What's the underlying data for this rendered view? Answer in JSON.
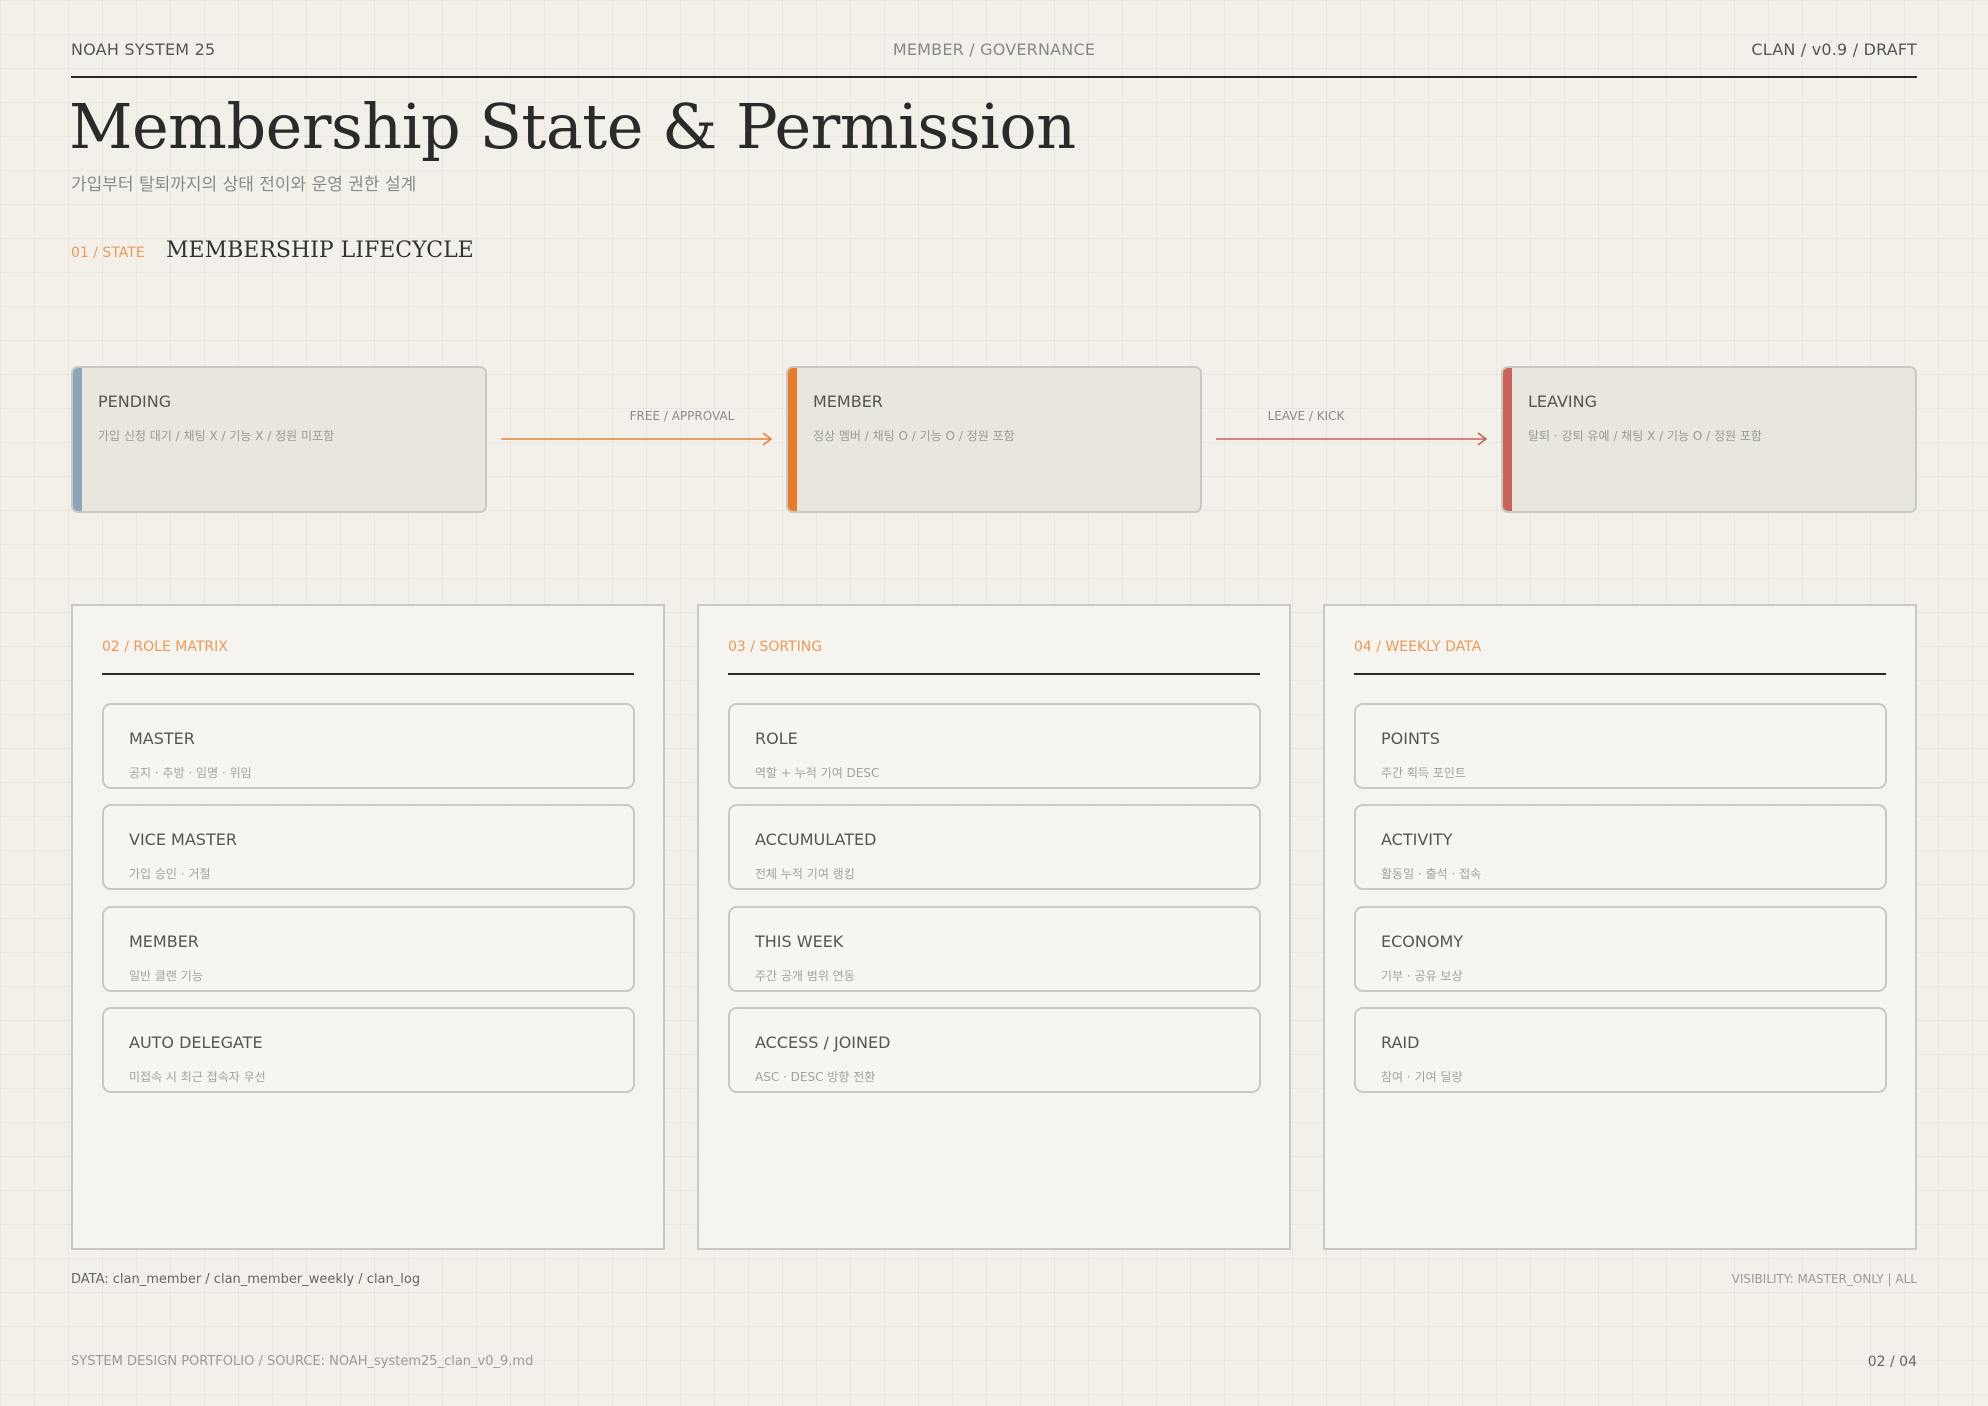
{
  "header": {
    "left": "NOAH SYSTEM 25",
    "center": "MEMBER / GOVERNANCE",
    "right": "CLAN / v0.9 / DRAFT"
  },
  "title": "Membership State & Permission",
  "subtitle": "가입부터 탈퇴까지의 상태 전이와 운영 권한 설계",
  "section": {
    "num": "01 / STATE",
    "title": "MEMBERSHIP LIFECYCLE"
  },
  "states": [
    {
      "name": "PENDING",
      "desc": "가입 신청 대기 / 채팅 X / 기능 X / 정원 미포함",
      "color": "#8aa6b8"
    },
    {
      "name": "MEMBER",
      "desc": "정상 멤버 / 채팅 O / 기능 O / 정원 포함",
      "color": "#e87a2c"
    },
    {
      "name": "LEAVING",
      "desc": "탈퇴 · 강퇴 유예 / 채팅 X / 기능 O / 정원 포함",
      "color": "#c8625a"
    }
  ],
  "transitions": [
    {
      "label": "FREE / APPROVAL",
      "color": "#e0823a"
    },
    {
      "label": "LEAVE / KICK",
      "color": "#c8625a"
    }
  ],
  "panels": [
    {
      "num": "02 / ROLE MATRIX",
      "items": [
        {
          "name": "MASTER",
          "desc": "공지 · 추방 · 임명 · 위임"
        },
        {
          "name": "VICE MASTER",
          "desc": "가입 승인 · 거절"
        },
        {
          "name": "MEMBER",
          "desc": "일반 클랜 기능"
        },
        {
          "name": "AUTO DELEGATE",
          "desc": "미접속 시 최근 접속자 우선"
        }
      ]
    },
    {
      "num": "03 / SORTING",
      "items": [
        {
          "name": "ROLE",
          "desc": "역할 + 누적 기여 DESC"
        },
        {
          "name": "ACCUMULATED",
          "desc": "전체 누적 기여 랭킹"
        },
        {
          "name": "THIS WEEK",
          "desc": "주간 공개 범위 연동"
        },
        {
          "name": "ACCESS / JOINED",
          "desc": "ASC · DESC 방향 전환"
        }
      ]
    },
    {
      "num": "04 / WEEKLY DATA",
      "items": [
        {
          "name": "POINTS",
          "desc": "주간 획득 포인트"
        },
        {
          "name": "ACTIVITY",
          "desc": "활동일 · 출석 · 접속"
        },
        {
          "name": "ECONOMY",
          "desc": "기부 · 공유 보상"
        },
        {
          "name": "RAID",
          "desc": "참여 · 기여 딜량"
        }
      ]
    }
  ],
  "footer": {
    "data": "DATA: clan_member / clan_member_weekly / clan_log",
    "visibility": "VISIBILITY: MASTER_ONLY | ALL",
    "source": "SYSTEM DESIGN PORTFOLIO / SOURCE: NOAH_system25_clan_v0_9.md",
    "page": "02 / 04"
  }
}
